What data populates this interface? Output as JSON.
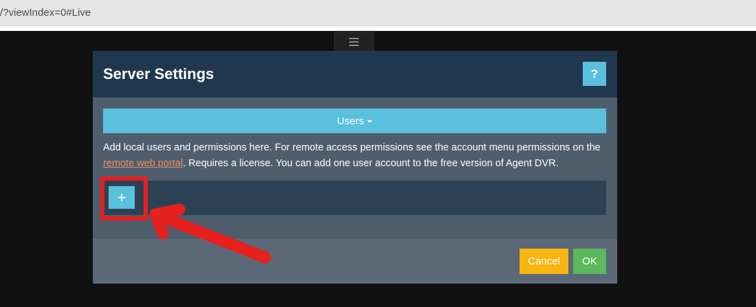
{
  "browser": {
    "url": "/?viewIndex=0#Live"
  },
  "icons": {
    "menu": "hamburger-menu-icon",
    "caret": "caret-down-icon",
    "add": "plus-icon",
    "arrow": "red-arrow-annotation"
  },
  "colors": {
    "header": "#21374d",
    "accent": "#5bc0de",
    "cancel": "#f8b410",
    "ok": "#5cb85c",
    "annotation": "#e8201e"
  },
  "modal": {
    "title": "Server Settings",
    "help_label": "?",
    "section_dropdown_label": "Users",
    "description": {
      "before_link": "Add local users and permissions here. For remote access permissions see the account menu permissions on the ",
      "link_text": "remote web portal",
      "after_link": ". Requires a license. You can add one user account to the free version of Agent DVR."
    },
    "add_label": "+",
    "cancel_label": "Cancel",
    "ok_label": "OK"
  }
}
